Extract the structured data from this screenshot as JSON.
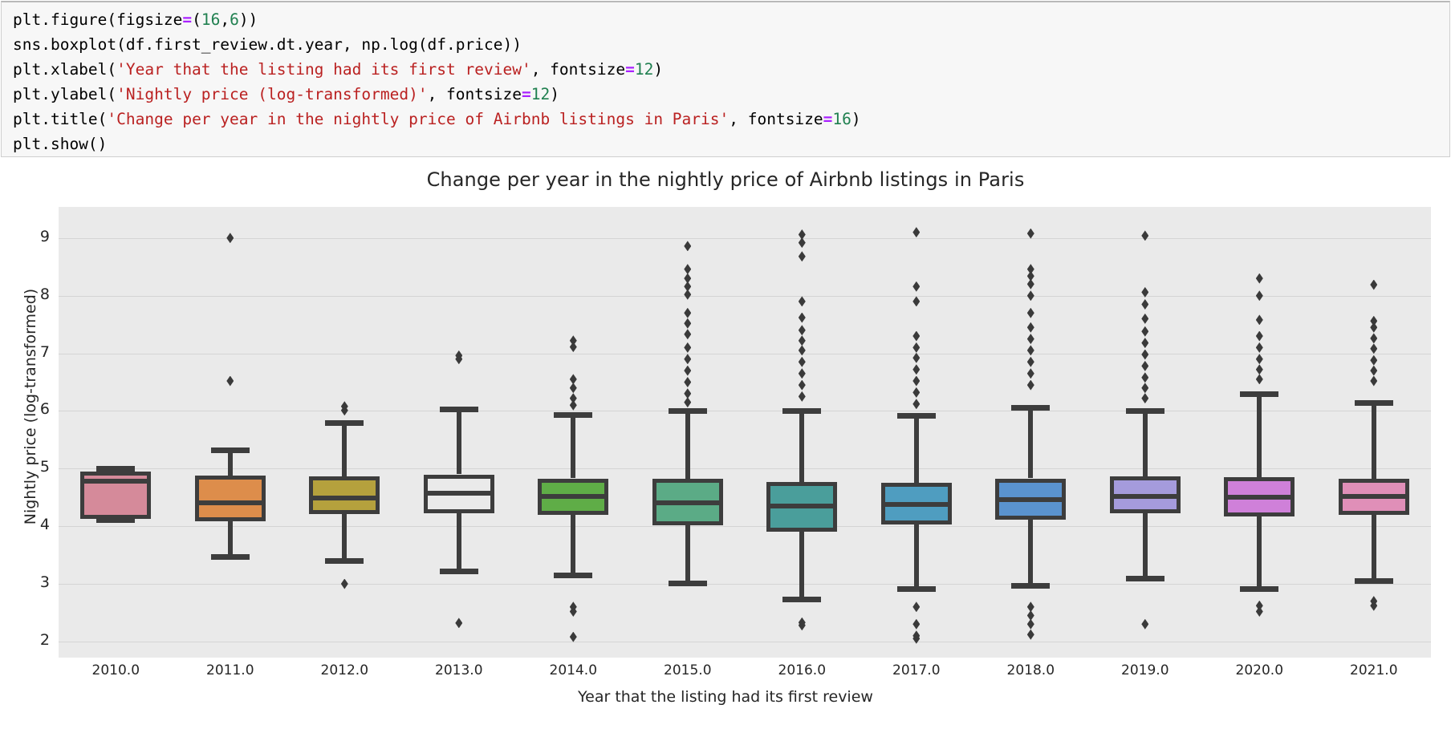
{
  "notebook": {
    "code_lines": [
      [
        {
          "t": "pl",
          "v": "plt.figure(figsize"
        },
        {
          "t": "op",
          "v": "="
        },
        {
          "t": "pl",
          "v": "("
        },
        {
          "t": "num",
          "v": "16"
        },
        {
          "t": "pl",
          "v": ","
        },
        {
          "t": "num",
          "v": "6"
        },
        {
          "t": "pl",
          "v": "))"
        }
      ],
      [
        {
          "t": "pl",
          "v": "sns.boxplot(df.first_review.dt.year, np.log(df.price))"
        }
      ],
      [
        {
          "t": "pl",
          "v": "plt.xlabel("
        },
        {
          "t": "str",
          "v": "'Year that the listing had its first review'"
        },
        {
          "t": "pl",
          "v": ", fontsize"
        },
        {
          "t": "op",
          "v": "="
        },
        {
          "t": "num",
          "v": "12"
        },
        {
          "t": "pl",
          "v": ")"
        }
      ],
      [
        {
          "t": "pl",
          "v": "plt.ylabel("
        },
        {
          "t": "str",
          "v": "'Nightly price (log-transformed)'"
        },
        {
          "t": "pl",
          "v": ", fontsize"
        },
        {
          "t": "op",
          "v": "="
        },
        {
          "t": "num",
          "v": "12"
        },
        {
          "t": "pl",
          "v": ")"
        }
      ],
      [
        {
          "t": "pl",
          "v": "plt.title("
        },
        {
          "t": "str",
          "v": "'Change per year in the nightly price of Airbnb listings in Paris'"
        },
        {
          "t": "pl",
          "v": ", fontsize"
        },
        {
          "t": "op",
          "v": "="
        },
        {
          "t": "num",
          "v": "16"
        },
        {
          "t": "pl",
          "v": ")"
        }
      ],
      [
        {
          "t": "pl",
          "v": "plt.show()"
        }
      ]
    ]
  },
  "chart_data": {
    "type": "box",
    "title": "Change per year in the nightly price of Airbnb listings in Paris",
    "xlabel": "Year that the listing had its first review",
    "ylabel": "Nightly price (log-transformed)",
    "xtick_labels": [
      "2010.0",
      "2011.0",
      "2012.0",
      "2013.0",
      "2014.0",
      "2015.0",
      "2016.0",
      "2017.0",
      "2018.0",
      "2019.0",
      "2020.0",
      "2021.0"
    ],
    "ytick_labels": [
      "2",
      "3",
      "4",
      "5",
      "6",
      "7",
      "8",
      "9"
    ],
    "yticks": [
      2,
      3,
      4,
      5,
      6,
      7,
      8,
      9
    ],
    "ylim": [
      1.72,
      9.54
    ],
    "grid": "y-only",
    "axes_facecolor": "#eaeaea",
    "artist_color": "#3d3d3d",
    "categories": [
      2010,
      2011,
      2012,
      2013,
      2014,
      2015,
      2016,
      2017,
      2018,
      2019,
      2020,
      2021
    ],
    "boxes": [
      {
        "label": "2010.0",
        "color": "#d58a9a",
        "q1": 4.12,
        "median": 4.78,
        "q3": 4.95,
        "whislo": 4.12,
        "whishi": 5.0,
        "fliers": []
      },
      {
        "label": "2011.0",
        "color": "#dd8d4b",
        "q1": 4.08,
        "median": 4.41,
        "q3": 4.88,
        "whislo": 3.48,
        "whishi": 5.32,
        "fliers": [
          9.0,
          6.52
        ]
      },
      {
        "label": "2012.0",
        "color": "#b5a13d",
        "q1": 4.21,
        "median": 4.49,
        "q3": 4.87,
        "whislo": 3.4,
        "whishi": 5.8,
        "fliers": [
          6.08,
          6.01,
          3.0
        ]
      },
      {
        "label": "2013.0",
        "color": "#a6b council",
        "q1": 4.23,
        "median": 4.57,
        "q3": 4.9,
        "whislo": 3.22,
        "whishi": 6.03,
        "fliers": [
          6.96,
          6.9,
          2.32
        ]
      },
      {
        "label": "2014.0",
        "color": "#5fad47",
        "q1": 4.2,
        "median": 4.52,
        "q3": 4.83,
        "whislo": 3.16,
        "whishi": 5.94,
        "fliers": [
          7.22,
          7.11,
          6.55,
          6.4,
          6.22,
          6.1,
          2.6,
          2.52,
          2.08
        ]
      },
      {
        "label": "2015.0",
        "color": "#5bab86",
        "q1": 4.01,
        "median": 4.4,
        "q3": 4.82,
        "whislo": 3.02,
        "whishi": 6.0,
        "fliers": [
          8.86,
          8.46,
          8.3,
          8.16,
          8.02,
          7.7,
          7.52,
          7.33,
          7.1,
          6.9,
          6.7,
          6.5,
          6.3,
          6.15
        ]
      },
      {
        "label": "2016.0",
        "color": "#4a9e9b",
        "q1": 3.91,
        "median": 4.35,
        "q3": 4.77,
        "whislo": 2.73,
        "whishi": 6.0,
        "fliers": [
          9.06,
          8.92,
          8.68,
          7.9,
          7.62,
          7.4,
          7.22,
          7.05,
          6.85,
          6.65,
          6.45,
          6.25,
          2.33,
          2.28
        ]
      },
      {
        "label": "2017.0",
        "color": "#4f9dc0",
        "q1": 4.03,
        "median": 4.38,
        "q3": 4.76,
        "whislo": 2.92,
        "whishi": 5.92,
        "fliers": [
          9.1,
          8.16,
          7.9,
          7.3,
          7.1,
          6.92,
          6.72,
          6.52,
          6.32,
          6.12,
          2.6,
          2.3,
          2.1,
          2.05
        ]
      },
      {
        "label": "2018.0",
        "color": "#5a93cf",
        "q1": 4.11,
        "median": 4.46,
        "q3": 4.83,
        "whislo": 2.97,
        "whishi": 6.06,
        "fliers": [
          9.08,
          8.46,
          8.34,
          8.2,
          8.0,
          7.7,
          7.45,
          7.25,
          7.05,
          6.85,
          6.65,
          6.45,
          2.6,
          2.45,
          2.3,
          2.12
        ]
      },
      {
        "label": "2019.0",
        "color": "#a59bdc",
        "q1": 4.22,
        "median": 4.52,
        "q3": 4.86,
        "whislo": 3.1,
        "whishi": 6.0,
        "fliers": [
          9.04,
          8.06,
          7.85,
          7.6,
          7.38,
          7.18,
          6.98,
          6.78,
          6.58,
          6.4,
          6.22,
          2.3
        ]
      },
      {
        "label": "2020.0",
        "color": "#cf80d9",
        "q1": 4.17,
        "median": 4.5,
        "q3": 4.85,
        "whislo": 2.92,
        "whishi": 6.3,
        "fliers": [
          8.3,
          8.0,
          7.58,
          7.3,
          7.1,
          6.9,
          6.72,
          6.55,
          2.62,
          2.52
        ]
      },
      {
        "label": "2021.0",
        "color": "#e08fb8",
        "q1": 4.2,
        "median": 4.52,
        "q3": 4.82,
        "whislo": 3.06,
        "whishi": 6.14,
        "fliers": [
          8.19,
          7.56,
          7.45,
          7.26,
          7.08,
          6.88,
          6.7,
          6.52,
          2.7,
          2.62
        ]
      }
    ]
  }
}
